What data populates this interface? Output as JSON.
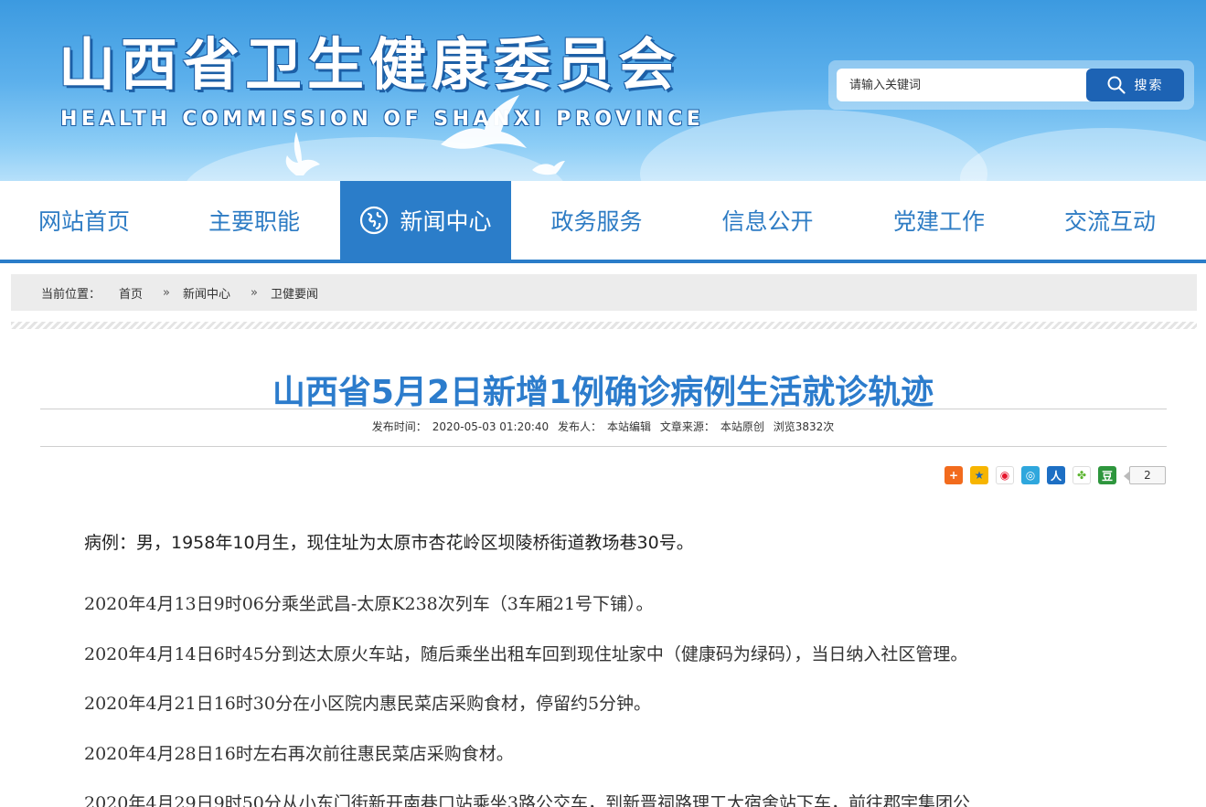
{
  "header": {
    "title": "山西省卫生健康委员会",
    "subtitle": "HEALTH COMMISSION OF SHANXI PROVINCE",
    "search": {
      "placeholder": "请输入关键词",
      "button_label": "搜索"
    }
  },
  "nav": {
    "items": [
      {
        "label": "网站首页"
      },
      {
        "label": "主要职能"
      },
      {
        "label": "新闻中心",
        "active": true
      },
      {
        "label": "政务服务"
      },
      {
        "label": "信息公开"
      },
      {
        "label": "党建工作"
      },
      {
        "label": "交流互动"
      }
    ]
  },
  "breadcrumb": {
    "prefix": "当前位置：",
    "items": [
      "首页",
      "新闻中心",
      "卫健要闻"
    ],
    "separator": "»"
  },
  "article": {
    "title": "山西省5月2日新增1例确诊病例生活就诊轨迹",
    "meta": {
      "published_label": "发布时间：",
      "published": "2020-05-03 01:20:40",
      "publisher_label": "发布人：",
      "publisher": "本站编辑",
      "source_label": "文章来源：",
      "source": "本站原创",
      "views": "浏览3832次"
    },
    "share": {
      "icons": [
        "plus-share-icon",
        "qzone-icon",
        "weibo-icon",
        "tencent-weibo-icon",
        "renren-icon",
        "kaixin-icon",
        "douban-icon"
      ],
      "count": "2"
    },
    "paragraphs": [
      "病例：男，1958年10月生，现住址为太原市杏花岭区坝陵桥街道教场巷30号。",
      "2020年4月13日9时06分乘坐武昌-太原K238次列车（3车厢21号下铺）。",
      "2020年4月14日6时45分到达太原火车站，随后乘坐出租车回到现住址家中（健康码为绿码），当日纳入社区管理。",
      "2020年4月21日16时30分在小区院内惠民菜店采购食材，停留约5分钟。",
      "2020年4月28日16时左右再次前往惠民菜店采购食材。",
      "2020年4月29日9时50分从小东门街新开南巷口站乘坐3路公交车，到新晋祠路理工大宿舍站下车，前往郡宇集团公"
    ]
  },
  "colors": {
    "brand_blue": "#2b7dc9",
    "title_blue": "#2c7ccc",
    "search_button": "#1d63b4"
  }
}
